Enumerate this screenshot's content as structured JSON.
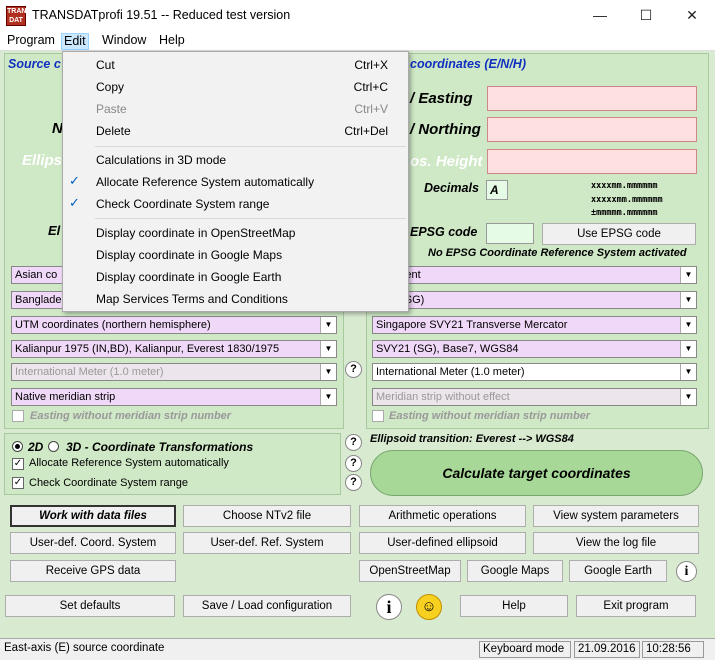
{
  "window": {
    "title": "TRANSDATprofi 19.51 -- Reduced test version",
    "icon_text": "TRANS DAT"
  },
  "menubar": [
    "Program",
    "Edit",
    "Window",
    "Help"
  ],
  "edit_menu": {
    "items": [
      {
        "label": "Cut",
        "shortcut": "Ctrl+X",
        "enabled": true
      },
      {
        "label": "Copy",
        "shortcut": "Ctrl+C",
        "enabled": true
      },
      {
        "label": "Paste",
        "shortcut": "Ctrl+V",
        "enabled": false
      },
      {
        "label": "Delete",
        "shortcut": "Ctrl+Del",
        "enabled": true
      },
      {
        "label": "Calculations in 3D mode",
        "checked": false
      },
      {
        "label": "Allocate Reference System automatically",
        "checked": true
      },
      {
        "label": "Check Coordinate System range",
        "checked": true
      },
      {
        "label": "Display coordinate in OpenStreetMap"
      },
      {
        "label": "Display coordinate in Google Maps"
      },
      {
        "label": "Display coordinate in Google Earth"
      },
      {
        "label": "Map Services Terms and Conditions"
      }
    ]
  },
  "source": {
    "header": "Source c",
    "n_label": "N",
    "ellips_label": "Ellips",
    "el_label": "El",
    "selects": [
      "Asian co",
      "Banglade",
      "UTM coordinates (northern hemisphere)",
      "Kalianpur 1975 (IN,BD), Kalianpur, Everest 1830/1975",
      "International Meter (1.0 meter)",
      "Native meridian strip"
    ],
    "easting_strip": "Easting without meridian strip number"
  },
  "target": {
    "header": "coordinates (E/N/H)",
    "easting": "/ Easting",
    "northing": "/ Northing",
    "height": "os. Height",
    "decimals_label": "Decimals",
    "decimals_value": "A",
    "fmt1": "xxxxmm.mmmmmm",
    "fmt2": "xxxxxmm.mmmmmm",
    "fmt3": "±mmmmm.mmmmmm",
    "epsg_label": "EPSG code",
    "epsg_button": "Use EPSG code",
    "epsg_status": "No EPSG Coordinate Reference System activated",
    "selects": [
      "continent",
      "pore (SG)",
      "Singapore SVY21 Transverse Mercator",
      "SVY21 (SG), Base7, WGS84",
      "International Meter (1.0 meter)",
      "Meridian strip without effect"
    ],
    "easting_strip": "Easting without meridian strip number",
    "ellipsoid_transition": "Ellipsoid transition: Everest --> WGS84",
    "calc_button": "Calculate target coordinates"
  },
  "options": {
    "mode_2d": "2D",
    "mode_3d": "3D - Coordinate Transformations",
    "allocate": "Allocate Reference System automatically",
    "check_range": "Check Coordinate System range"
  },
  "buttons": {
    "row1": [
      "Work with data files",
      "Choose NTv2 file",
      "Arithmetic operations",
      "View system parameters"
    ],
    "row2": [
      "User-def. Coord. System",
      "User-def. Ref. System",
      "User-defined ellipsoid",
      "View the log file"
    ],
    "row3": [
      "Receive GPS data",
      "OpenStreetMap",
      "Google Maps",
      "Google Earth"
    ],
    "row4": [
      "Set defaults",
      "Save / Load configuration",
      "Help",
      "Exit program"
    ]
  },
  "statusbar": {
    "message": "East-axis (E) source coordinate",
    "mode": "Keyboard mode",
    "date": "21.09.2016",
    "time": "10:28:56"
  },
  "colors": {
    "header_blue": "#1030c0",
    "panel_green": "#cfe8c6",
    "input_pink": "#ffe0e0",
    "select_lilac": "#f0d8f8"
  }
}
